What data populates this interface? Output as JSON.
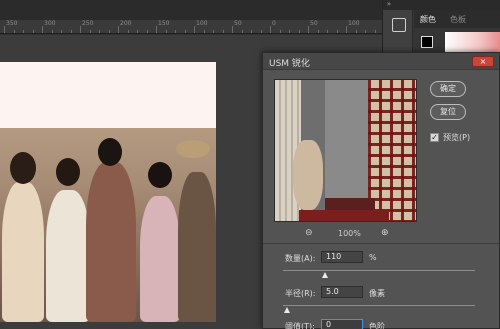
{
  "ruler": {
    "numbers": [
      "350",
      "300",
      "250",
      "200",
      "150",
      "100",
      "50",
      "0",
      "50",
      "100"
    ]
  },
  "right_panel": {
    "collapse_arrow": "»",
    "tabs": [
      {
        "label": "颜色",
        "active": true
      },
      {
        "label": "色板",
        "active": false
      }
    ],
    "foreground_color": "#000000"
  },
  "dialog": {
    "title": "USM 锐化",
    "close_glyph": "×",
    "buttons": {
      "ok": "确定",
      "reset": "复位"
    },
    "preview_checkbox": {
      "label": "预览(P)",
      "checked": true,
      "mark": "✓"
    },
    "zoom": {
      "out_icon": "⊖",
      "value": "100%",
      "in_icon": "⊕"
    },
    "amount": {
      "label": "数量(A):",
      "value": "110",
      "unit": "%",
      "slider_level": 0.22
    },
    "radius": {
      "label": "半径(R):",
      "value": "5.0",
      "unit": "像素",
      "slider_level": 0.02
    },
    "threshold": {
      "label": "阈值(T):",
      "value": "0",
      "unit": "色阶"
    }
  },
  "colors": {
    "close_button": "#c9453a",
    "focus_border": "#4a8ff0",
    "document_bg": "#fdf4f2"
  }
}
